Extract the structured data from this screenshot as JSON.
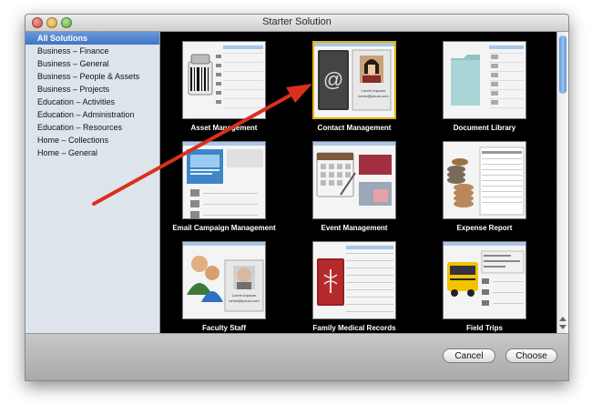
{
  "window": {
    "title": "Starter Solution"
  },
  "sidebar": {
    "items": [
      {
        "label": "All Solutions",
        "selected": true
      },
      {
        "label": "Business – Finance"
      },
      {
        "label": "Business – General"
      },
      {
        "label": "Business – People & Assets"
      },
      {
        "label": "Business – Projects"
      },
      {
        "label": "Education – Activities"
      },
      {
        "label": "Education – Administration"
      },
      {
        "label": "Education – Resources"
      },
      {
        "label": "Home – Collections"
      },
      {
        "label": "Home – General"
      }
    ]
  },
  "solutions": [
    {
      "label": "Asset Management",
      "icon": "barcode-scanner-icon"
    },
    {
      "label": "Contact Management",
      "icon": "address-book-icon",
      "selected": true,
      "card_text": [
        "Lorem Impsum",
        "lorem@ipsum.com"
      ]
    },
    {
      "label": "Document Library",
      "icon": "folder-icon"
    },
    {
      "label": "Email Campaign Management",
      "icon": "email-campaign-icon"
    },
    {
      "label": "Event Management",
      "icon": "calendar-icon"
    },
    {
      "label": "Expense Report",
      "icon": "coins-icon"
    },
    {
      "label": "Faculty Staff",
      "icon": "people-icon",
      "card_text": [
        "Lorem Impsum",
        "lorem@ipsum.com"
      ]
    },
    {
      "label": "Family Medical Records",
      "icon": "medical-book-icon"
    },
    {
      "label": "Field Trips",
      "icon": "school-bus-icon"
    }
  ],
  "buttons": {
    "cancel": "Cancel",
    "choose": "Choose"
  },
  "colors": {
    "selection": "#3d74c6",
    "selected_border": "#e2b300",
    "annotation_arrow": "#d9301c"
  }
}
